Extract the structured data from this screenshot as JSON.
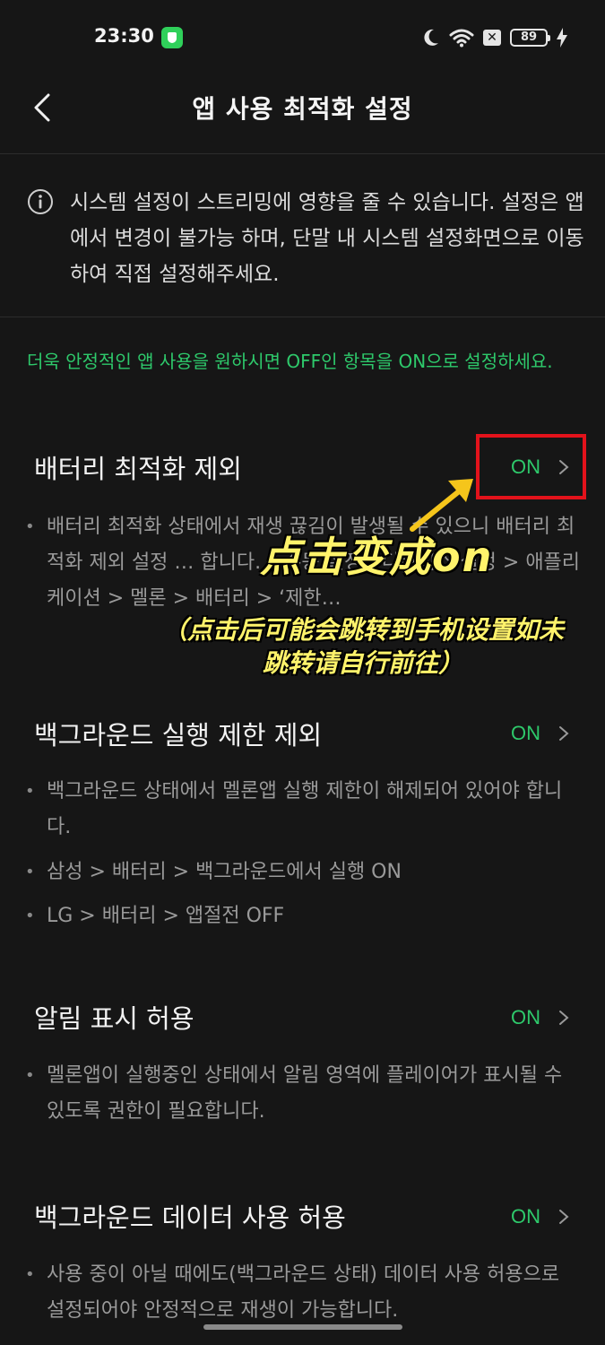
{
  "status_bar": {
    "time": "23:30",
    "battery": "89"
  },
  "header": {
    "title": "앱 사용 최적화 설정"
  },
  "notice": {
    "text": "시스템 설정이 스트리밍에 영향을 줄 수 있습니다. 설정은 앱에서 변경이 불가능 하며, 단말 내 시스템 설정화면으로 이동하여 직접 설정해주세요."
  },
  "guide": {
    "text": "더욱 안정적인 앱 사용을 원하시면 OFF인 항목을 ON으로 설정하세요."
  },
  "settings": [
    {
      "title": "배터리 최적화 제외",
      "status": "ON",
      "bullets": [
        "배터리 최적화 상태에서 재생 끊김이 발생될 수 있으니 배터리 최적화 제외 설정 … 합니다. * 수동 설정 : 디바이스 설정 > 애플리케이션 > 멜론 > 배터리 > ‘제한…"
      ]
    },
    {
      "title": "백그라운드 실행 제한 제외",
      "status": "ON",
      "bullets": [
        "백그라운드 상태에서 멜론앱 실행 제한이 해제되어 있어야 합니다.",
        "삼성 > 배터리 > 백그라운드에서 실행 ON",
        "LG > 배터리 > 앱절전 OFF"
      ]
    },
    {
      "title": "알림 표시 허용",
      "status": "ON",
      "bullets": [
        "멜론앱이 실행중인 상태에서 알림 영역에 플레이어가 표시될 수 있도록 권한이 필요합니다."
      ]
    },
    {
      "title": "백그라운드 데이터 사용 허용",
      "status": "ON",
      "bullets": [
        "사용 중이 아닐 때에도(백그라운드 상태) 데이터 사용 허용으로 설정되어야 안정적으로 재생이 가능합니다."
      ]
    }
  ],
  "annotation": {
    "main": "点击变成on",
    "sub": "（点击后可能会跳转到手机设置如未跳转请自行前往）"
  },
  "colors": {
    "accent_green": "#2ec96b",
    "highlight_red": "#e3121b",
    "annotation_yellow": "#fff36b",
    "background": "#161616"
  }
}
